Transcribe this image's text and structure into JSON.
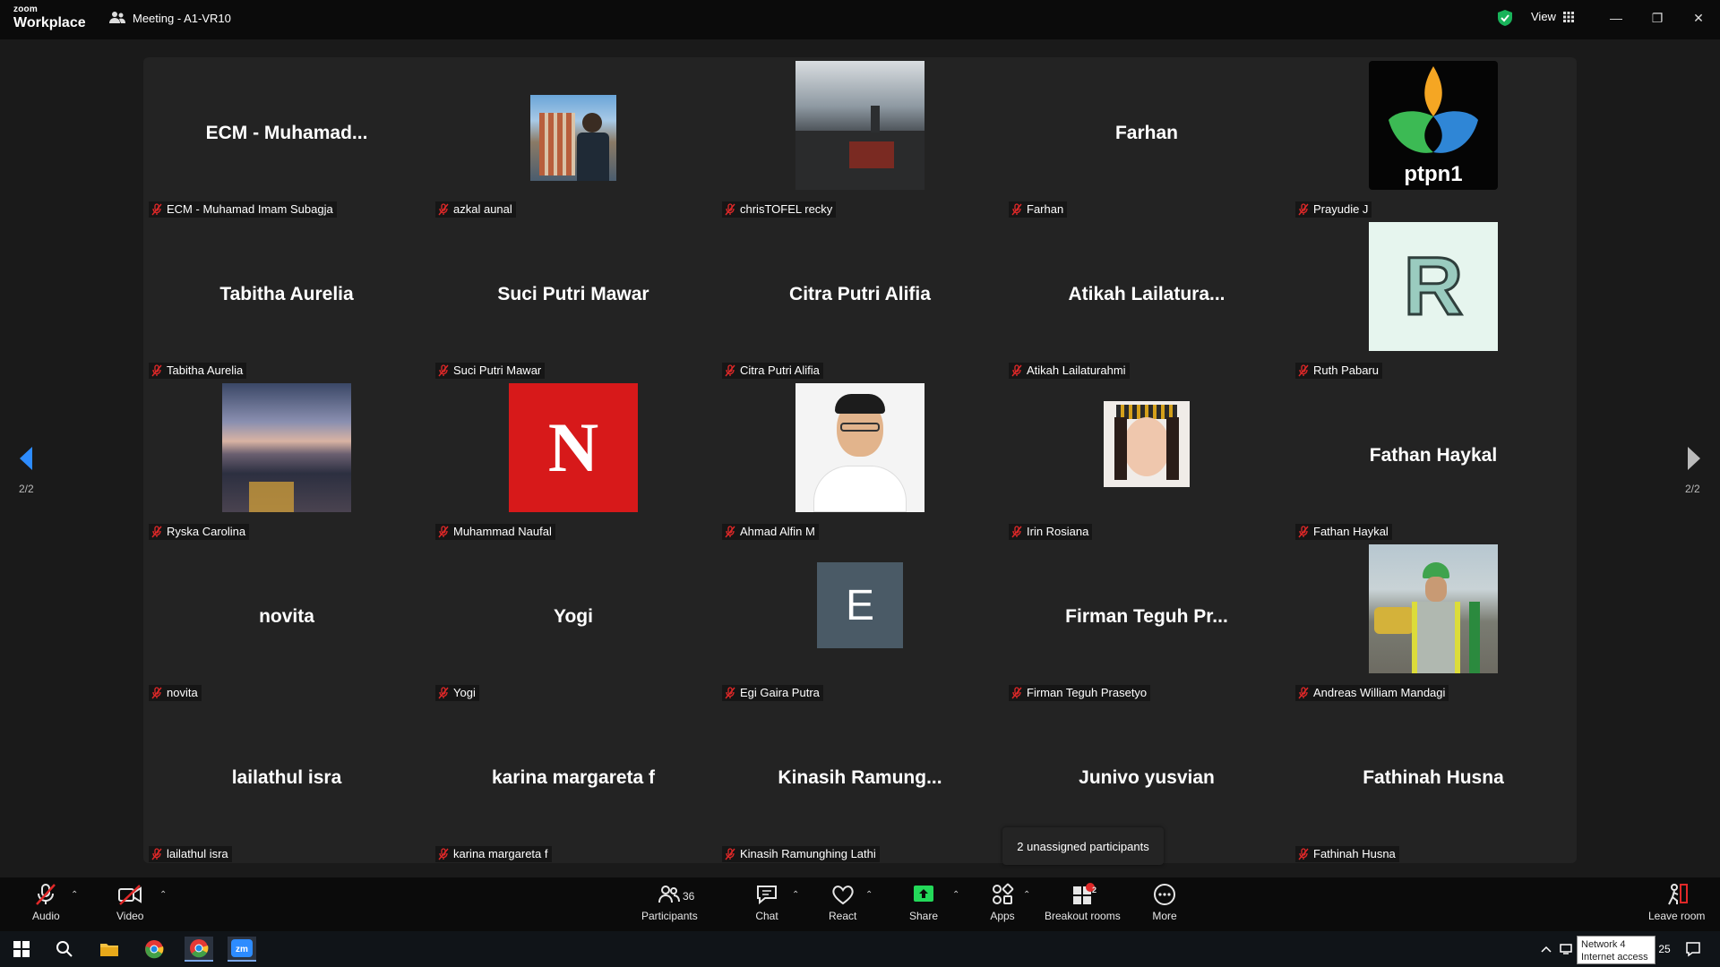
{
  "titlebar": {
    "brand_top": "zoom",
    "brand_bottom": "Workplace",
    "meeting_title": "Meeting - A1-VR10",
    "view_label": "View"
  },
  "participants": [
    {
      "big": "ECM  -  Muhamad...",
      "label": "ECM - Muhamad Imam Subagja",
      "avatar": null
    },
    {
      "big": "",
      "label": "azkal aunal",
      "avatar": "photo-building"
    },
    {
      "big": "",
      "label": "chrisTOFEL recky",
      "avatar": "photo-cliff"
    },
    {
      "big": "Farhan",
      "label": "Farhan",
      "avatar": null
    },
    {
      "big": "",
      "label": "Prayudie J",
      "avatar": "logo-ptpn1"
    },
    {
      "big": "Tabitha Aurelia",
      "label": "Tabitha Aurelia",
      "avatar": null
    },
    {
      "big": "Suci Putri Mawar",
      "label": "Suci Putri Mawar",
      "avatar": null
    },
    {
      "big": "Citra Putri Alifia",
      "label": "Citra Putri Alifia",
      "avatar": null
    },
    {
      "big": "Atikah  Lailatura...",
      "label": "Atikah Lailaturahmi",
      "avatar": null
    },
    {
      "big": "",
      "label": "Ruth Pabaru",
      "avatar": "letter-R"
    },
    {
      "big": "",
      "label": "Ryska Carolina",
      "avatar": "photo-sunset"
    },
    {
      "big": "",
      "label": "Muhammad Naufal",
      "avatar": "letter-N"
    },
    {
      "big": "",
      "label": "Ahmad Alfin M",
      "avatar": "photo-portrait-man"
    },
    {
      "big": "",
      "label": "Irin Rosiana",
      "avatar": "photo-portrait-woman"
    },
    {
      "big": "Fathan Haykal",
      "label": "Fathan Haykal",
      "avatar": null
    },
    {
      "big": "novita",
      "label": "novita",
      "avatar": null
    },
    {
      "big": "Yogi",
      "label": "Yogi",
      "avatar": null
    },
    {
      "big": "",
      "label": "Egi Gaira Putra",
      "avatar": "letter-E"
    },
    {
      "big": "Firman  Teguh  Pr...",
      "label": "Firman Teguh Prasetyo",
      "avatar": null
    },
    {
      "big": "",
      "label": "Andreas William Mandagi",
      "avatar": "photo-worker"
    },
    {
      "big": "lailathul isra",
      "label": "lailathul isra",
      "avatar": null
    },
    {
      "big": "karina margareta f",
      "label": "karina margareta f",
      "avatar": null
    },
    {
      "big": "Kinasih  Ramung...",
      "label": "Kinasih Ramunghing Lathi",
      "avatar": null
    },
    {
      "big": "Junivo yusvian",
      "label": "",
      "avatar": null
    },
    {
      "big": "Fathinah Husna",
      "label": "Fathinah Husna",
      "avatar": null
    }
  ],
  "avatars": {
    "letter_R": "R",
    "letter_N": "N",
    "letter_E": "E",
    "ptpn_text": "ptpn1"
  },
  "pager": {
    "left": "2/2",
    "right": "2/2"
  },
  "tooltip": "2 unassigned participants",
  "toolbar": {
    "audio": "Audio",
    "video": "Video",
    "participants": "Participants",
    "participants_count": "36",
    "chat": "Chat",
    "react": "React",
    "share": "Share",
    "apps": "Apps",
    "breakout": "Breakout rooms",
    "breakout_badge": "2",
    "more": "More",
    "leave": "Leave room"
  },
  "taskbar": {
    "network_line1": "Network 4",
    "network_line2": "Internet access",
    "clock_fragment": "25"
  },
  "colors": {
    "accent_blue": "#2d8cff",
    "share_green": "#23d959",
    "mic_red": "#e02828",
    "tile_bg": "#232323"
  }
}
